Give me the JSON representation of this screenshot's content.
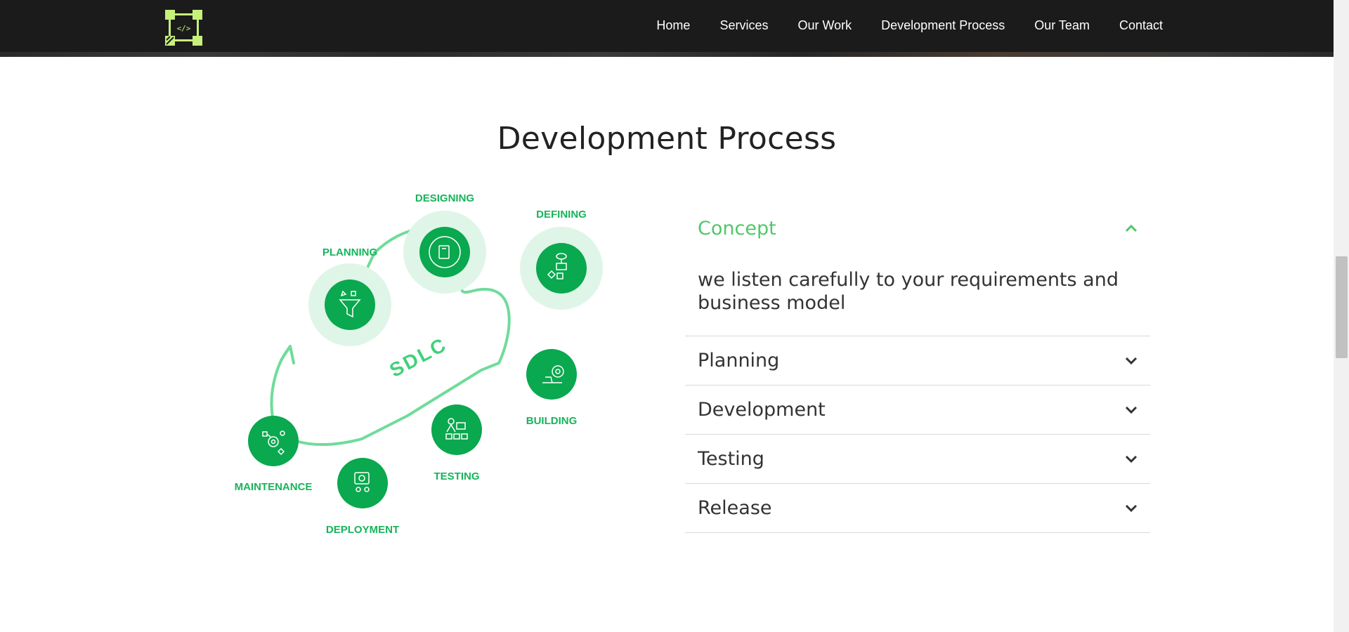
{
  "nav": {
    "logo_text": "</>",
    "links": [
      "Home",
      "Services",
      "Our Work",
      "Development Process",
      "Our Team",
      "Contact"
    ]
  },
  "section": {
    "title": "Development Process"
  },
  "diagram": {
    "center_label": "SDLC",
    "stages": [
      "DESIGNING",
      "DEFINING",
      "PLANNING",
      "BUILDING",
      "TESTING",
      "MAINTENANCE",
      "DEPLOYMENT"
    ]
  },
  "accordion": {
    "items": [
      {
        "title": "Concept",
        "body": "we listen carefully to your requirements and business model",
        "expanded": true
      },
      {
        "title": "Planning",
        "expanded": false
      },
      {
        "title": "Development",
        "expanded": false
      },
      {
        "title": "Testing",
        "expanded": false
      },
      {
        "title": "Release",
        "expanded": false
      }
    ]
  },
  "colors": {
    "accent": "#52c66a",
    "stage_green": "#0aa84f",
    "stage_halo": "#dff5e8",
    "loop_line": "#6fdc9a",
    "nav_bg": "#1b1b1b",
    "logo_green": "#c6f07a"
  }
}
